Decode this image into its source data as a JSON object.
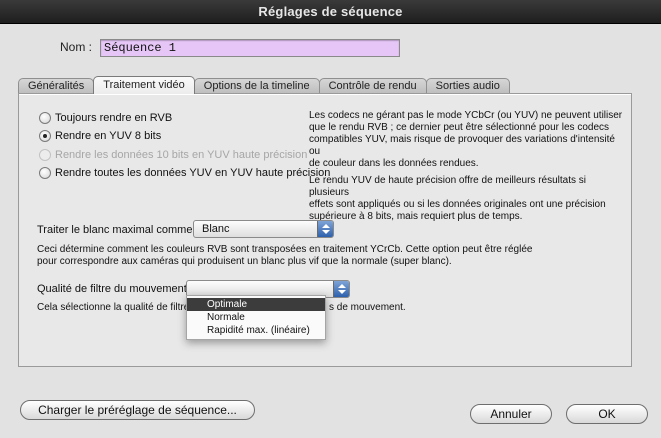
{
  "window": {
    "title": "Réglages de séquence"
  },
  "name": {
    "label": "Nom :",
    "value": "Séquence 1"
  },
  "tabs": [
    {
      "label": "Généralités",
      "active": false
    },
    {
      "label": "Traitement vidéo",
      "active": true
    },
    {
      "label": "Options de la timeline",
      "active": false
    },
    {
      "label": "Contrôle de rendu",
      "active": false
    },
    {
      "label": "Sorties audio",
      "active": false
    }
  ],
  "render_options": [
    {
      "label": "Toujours rendre en RVB",
      "checked": false,
      "disabled": false
    },
    {
      "label": "Rendre en YUV 8 bits",
      "checked": true,
      "disabled": false
    },
    {
      "label": "Rendre les données 10 bits en YUV haute précision",
      "checked": false,
      "disabled": true
    },
    {
      "label": "Rendre toutes les données YUV en YUV haute précision",
      "checked": false,
      "disabled": false
    }
  ],
  "info": {
    "para1_line1": "Les codecs ne gérant pas le mode YCbCr (ou YUV) ne peuvent utiliser",
    "para1_line2": "que le rendu RVB ; ce dernier peut être sélectionné pour les codecs",
    "para1_line3": "compatibles YUV, mais risque de provoquer des variations d'intensité ou",
    "para1_line4": "de couleur dans les données rendues.",
    "para2_line1": "Le rendu YUV de haute précision offre de meilleurs résultats si plusieurs",
    "para2_line2": "effets sont appliqués ou si les données originales ont une précision",
    "para2_line3": "supérieure à 8 bits, mais requiert plus de temps."
  },
  "white": {
    "label": "Traiter le blanc maximal comme :",
    "value": "Blanc",
    "desc_line1": "Ceci détermine comment les couleurs RVB sont transposées en traitement YCrCb. Cette option peut être réglée",
    "desc_line2": "pour correspondre aux caméras qui produisent un blanc plus vif que la normale (super blanc)."
  },
  "motion": {
    "label": "Qualité de filtre du mouvement :",
    "desc_left": "Cela sélectionne la qualité de filtre",
    "desc_right": "s de mouvement.",
    "options": [
      "Optimale",
      "Normale",
      "Rapidité max. (linéaire)"
    ],
    "selected": "Optimale"
  },
  "buttons": {
    "load_preset": "Charger le préréglage de séquence...",
    "cancel": "Annuler",
    "ok": "OK"
  },
  "colors": {
    "name_field_bg": "#e6c6f6",
    "menu_highlight": "#3c3c3c",
    "titlebar": "#2a2a2a"
  }
}
